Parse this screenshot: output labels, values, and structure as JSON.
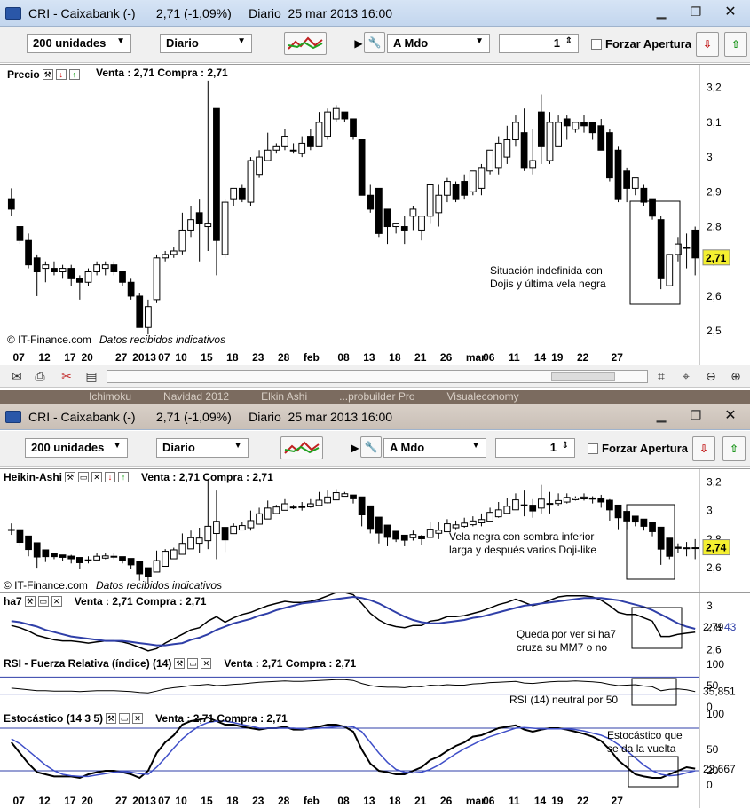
{
  "window1": {
    "title": "CRI - Caixabank (-)      2,71 (-1,09%)     Diario  25 mar 2013 16:00"
  },
  "window2": {
    "title": "CRI - Caixabank (-)      2,71 (-1,09%)     Diario  25 mar 2013 16:00",
    "behind_tabs": [
      "Ichimoku",
      "Navidad 2012",
      "Elkin Ashi",
      "...probuilder Pro",
      "Visualeconomy"
    ]
  },
  "toolbar": {
    "units": "200 unidades",
    "period": "Diario",
    "order_type": "A Mdo",
    "quantity": "1",
    "force_open": "Forzar Apertura"
  },
  "quote_text": "Venta : 2,71 Compra : 2,71",
  "credit": "© IT-Finance.com",
  "credit_note": "Datos recibidos indicativos",
  "x_labels": [
    "07",
    "12",
    "17",
    "20",
    "27",
    "2013",
    "07",
    "10",
    "15",
    "18",
    "23",
    "28",
    "feb",
    "08",
    "13",
    "18",
    "21",
    "26",
    "mar",
    "06",
    "11",
    "14",
    "19",
    "22",
    "27"
  ],
  "price_panel": {
    "title": "Precio",
    "y_labels": [
      "3,2",
      "3,1",
      "3",
      "2,9",
      "2,8",
      "2,7",
      "2,6",
      "2,5"
    ],
    "last_badge": "2,71",
    "annotation": [
      "Situación indefinida con",
      "Dojis y última vela negra"
    ]
  },
  "ha_panel": {
    "title": "Heikin-Ashi",
    "y_labels": [
      "3,2",
      "3",
      "2,8",
      "2,6"
    ],
    "last_badge": "2,74",
    "annotation": [
      "Vela negra con sombra inferior",
      "larga y después varios Doji-like"
    ]
  },
  "ha7_panel": {
    "title": "ha7",
    "y_labels": [
      "3",
      "2,8",
      "2,6"
    ],
    "last_value": "2,79",
    "last_value2": "43",
    "annotation": [
      "Queda por ver si ha7",
      "cruza su MM7 o no"
    ]
  },
  "rsi_panel": {
    "title": "RSI - Fuerza Relativa (índice) (14)",
    "y_labels": [
      "100",
      "50",
      "0"
    ],
    "last_value": "35,851",
    "annotation": "RSI (14) neutral por 50"
  },
  "stoch_panel": {
    "title": "Estocástico (14 3 5)",
    "y_labels": [
      "100",
      "50",
      "20",
      "0"
    ],
    "last_value": "22,667",
    "annotation": [
      "Estocástico que",
      "se da la vuelta"
    ]
  },
  "chart_data": {
    "type": "candlestick",
    "price": {
      "open": [
        2.88,
        2.8,
        2.76,
        2.71,
        2.68,
        2.68,
        2.67,
        2.68,
        2.65,
        2.64,
        2.67,
        2.68,
        2.69,
        2.67,
        2.64,
        2.6,
        2.51,
        2.59,
        2.71,
        2.72,
        2.73,
        2.79,
        2.84,
        2.8,
        3.14,
        2.72,
        2.88,
        2.91,
        2.87,
        2.95,
        2.99,
        3.02,
        3.03,
        3.02,
        3.01,
        3.06,
        3.03,
        3.06,
        3.11,
        3.13,
        3.11,
        3.05,
        2.89,
        2.91,
        2.85,
        2.8,
        2.8,
        2.83,
        2.79,
        2.83,
        2.84,
        2.89,
        2.92,
        2.93,
        2.9,
        2.91,
        2.96,
        2.97,
        3.0,
        3.05,
        3.07,
        2.97,
        3.13,
        2.99,
        3.03,
        3.11,
        3.08,
        3.1,
        3.1,
        3.09,
        3.07,
        3.02,
        2.96,
        2.91,
        2.91,
        2.88,
        2.82,
        2.63,
        2.72,
        2.74,
        2.79
      ],
      "close": [
        2.85,
        2.76,
        2.69,
        2.67,
        2.69,
        2.67,
        2.68,
        2.65,
        2.64,
        2.67,
        2.69,
        2.69,
        2.67,
        2.64,
        2.6,
        2.51,
        2.57,
        2.71,
        2.72,
        2.73,
        2.79,
        2.82,
        2.81,
        2.81,
        2.76,
        2.87,
        2.91,
        2.88,
        2.99,
        3.0,
        3.02,
        3.03,
        3.06,
        3.02,
        3.04,
        3.03,
        3.1,
        3.13,
        3.14,
        3.11,
        3.06,
        2.89,
        2.85,
        2.78,
        2.8,
        2.81,
        2.79,
        2.85,
        2.83,
        2.92,
        2.89,
        2.93,
        2.88,
        2.89,
        2.96,
        2.97,
        3.02,
        3.04,
        3.05,
        3.1,
        2.97,
        2.99,
        3.03,
        3.1,
        3.1,
        3.09,
        3.1,
        3.09,
        3.07,
        3.02,
        2.94,
        2.88,
        2.91,
        2.94,
        2.87,
        2.83,
        2.65,
        2.72,
        2.75,
        2.74,
        2.71
      ],
      "high": [
        2.91,
        2.8,
        2.78,
        2.72,
        2.7,
        2.7,
        2.69,
        2.69,
        2.66,
        2.68,
        2.7,
        2.7,
        2.7,
        2.67,
        2.65,
        2.61,
        2.59,
        2.72,
        2.73,
        2.74,
        2.84,
        2.86,
        2.88,
        3.22,
        3.14,
        2.88,
        2.91,
        2.92,
        3.0,
        3.02,
        3.07,
        3.04,
        3.08,
        3.04,
        3.06,
        3.08,
        3.13,
        3.14,
        3.15,
        3.13,
        3.11,
        3.05,
        2.92,
        2.91,
        2.85,
        2.81,
        2.83,
        2.86,
        2.83,
        2.92,
        2.92,
        2.94,
        2.93,
        2.95,
        2.96,
        2.98,
        3.02,
        3.06,
        3.09,
        3.12,
        3.14,
        3.08,
        3.18,
        3.13,
        3.12,
        3.12,
        3.1,
        3.12,
        3.1,
        3.11,
        3.08,
        3.03,
        2.97,
        2.94,
        2.92,
        2.88,
        2.83,
        2.71,
        2.77,
        2.78,
        2.8
      ],
      "low": [
        2.83,
        2.75,
        2.68,
        2.6,
        2.64,
        2.66,
        2.65,
        2.63,
        2.59,
        2.63,
        2.66,
        2.66,
        2.66,
        2.63,
        2.59,
        2.51,
        2.49,
        2.58,
        2.7,
        2.71,
        2.72,
        2.77,
        2.7,
        2.73,
        2.66,
        2.71,
        2.86,
        2.87,
        2.86,
        2.94,
        2.99,
        3.01,
        3.02,
        3.01,
        3.0,
        3.02,
        3.03,
        3.05,
        3.1,
        3.1,
        3.05,
        2.89,
        2.84,
        2.77,
        2.75,
        2.78,
        2.75,
        2.79,
        2.76,
        2.81,
        2.8,
        2.87,
        2.87,
        2.88,
        2.89,
        2.89,
        2.95,
        2.95,
        2.98,
        3.03,
        2.96,
        2.95,
        2.98,
        2.98,
        3.03,
        3.05,
        3.07,
        3.07,
        3.05,
        3.02,
        2.93,
        2.87,
        2.87,
        2.89,
        2.86,
        2.82,
        2.62,
        2.66,
        2.7,
        2.68,
        2.66
      ]
    },
    "ha7": [
      2.82,
      2.8,
      2.77,
      2.73,
      2.71,
      2.69,
      2.68,
      2.68,
      2.67,
      2.66,
      2.67,
      2.68,
      2.68,
      2.67,
      2.65,
      2.62,
      2.59,
      2.61,
      2.66,
      2.7,
      2.74,
      2.78,
      2.8,
      2.86,
      2.9,
      2.85,
      2.89,
      2.92,
      2.94,
      2.97,
      3.0,
      3.02,
      3.04,
      3.03,
      3.03,
      3.04,
      3.06,
      3.09,
      3.12,
      3.12,
      3.1,
      3.02,
      2.93,
      2.87,
      2.83,
      2.81,
      2.8,
      2.82,
      2.82,
      2.86,
      2.87,
      2.9,
      2.9,
      2.91,
      2.93,
      2.95,
      2.98,
      3.01,
      3.03,
      3.06,
      3.03,
      3.0,
      3.02,
      3.05,
      3.08,
      3.09,
      3.09,
      3.09,
      3.08,
      3.05,
      3.0,
      2.94,
      2.92,
      2.92,
      2.89,
      2.86,
      2.72,
      2.72,
      2.74,
      2.75,
      2.76
    ],
    "ha7_mm7": [
      2.86,
      2.85,
      2.83,
      2.81,
      2.78,
      2.76,
      2.74,
      2.72,
      2.71,
      2.7,
      2.69,
      2.68,
      2.68,
      2.68,
      2.67,
      2.66,
      2.65,
      2.64,
      2.64,
      2.65,
      2.66,
      2.69,
      2.71,
      2.74,
      2.78,
      2.81,
      2.84,
      2.86,
      2.88,
      2.91,
      2.93,
      2.96,
      2.98,
      3.0,
      3.02,
      3.03,
      3.04,
      3.05,
      3.06,
      3.07,
      3.08,
      3.07,
      3.05,
      3.02,
      2.98,
      2.94,
      2.9,
      2.87,
      2.85,
      2.84,
      2.84,
      2.85,
      2.86,
      2.87,
      2.89,
      2.9,
      2.92,
      2.94,
      2.96,
      2.98,
      3.0,
      3.01,
      3.02,
      3.03,
      3.04,
      3.05,
      3.06,
      3.07,
      3.07,
      3.07,
      3.06,
      3.05,
      3.03,
      3.01,
      2.99,
      2.96,
      2.92,
      2.88,
      2.84,
      2.81,
      2.79
    ],
    "rsi14": [
      44,
      42,
      40,
      38,
      38,
      37,
      37,
      37,
      36,
      37,
      38,
      38,
      38,
      37,
      36,
      34,
      33,
      37,
      42,
      45,
      47,
      50,
      51,
      53,
      50,
      51,
      53,
      54,
      56,
      58,
      59,
      60,
      61,
      60,
      60,
      61,
      62,
      63,
      64,
      64,
      62,
      55,
      50,
      47,
      46,
      46,
      45,
      48,
      47,
      51,
      50,
      52,
      51,
      51,
      54,
      55,
      57,
      58,
      59,
      60,
      56,
      55,
      57,
      59,
      60,
      60,
      61,
      60,
      59,
      57,
      53,
      50,
      51,
      52,
      49,
      47,
      38,
      41,
      42,
      40,
      36
    ],
    "stoch_k": [
      60,
      45,
      30,
      18,
      15,
      12,
      12,
      12,
      10,
      15,
      18,
      20,
      20,
      18,
      15,
      10,
      20,
      45,
      60,
      70,
      85,
      90,
      92,
      95,
      90,
      85,
      85,
      82,
      80,
      78,
      80,
      80,
      82,
      78,
      78,
      80,
      82,
      85,
      85,
      82,
      75,
      50,
      30,
      20,
      18,
      15,
      15,
      20,
      25,
      35,
      40,
      48,
      55,
      60,
      68,
      70,
      75,
      80,
      82,
      84,
      78,
      75,
      78,
      80,
      80,
      78,
      75,
      72,
      68,
      62,
      50,
      35,
      25,
      15,
      12,
      10,
      10,
      15,
      20,
      25,
      23
    ],
    "stoch_d": [
      65,
      58,
      48,
      38,
      28,
      20,
      15,
      13,
      12,
      12,
      14,
      16,
      18,
      19,
      18,
      16,
      15,
      25,
      38,
      52,
      65,
      75,
      83,
      88,
      90,
      90,
      88,
      85,
      83,
      80,
      80,
      80,
      80,
      80,
      79,
      79,
      80,
      81,
      82,
      83,
      82,
      75,
      60,
      45,
      32,
      22,
      18,
      17,
      18,
      22,
      28,
      36,
      44,
      51,
      57,
      63,
      68,
      72,
      76,
      80,
      81,
      80,
      79,
      79,
      79,
      79,
      78,
      76,
      73,
      70,
      65,
      57,
      48,
      38,
      28,
      20,
      15,
      13,
      14,
      17,
      20
    ],
    "price_range": [
      2.48,
      3.24
    ],
    "ha_range": [
      2.52,
      3.24
    ],
    "ha7_range": [
      2.58,
      3.08
    ],
    "rsi_range": [
      0,
      100
    ],
    "stoch_range": [
      0,
      100
    ],
    "rsi_levels": [
      70,
      30
    ],
    "stoch_levels": [
      80,
      20
    ]
  }
}
